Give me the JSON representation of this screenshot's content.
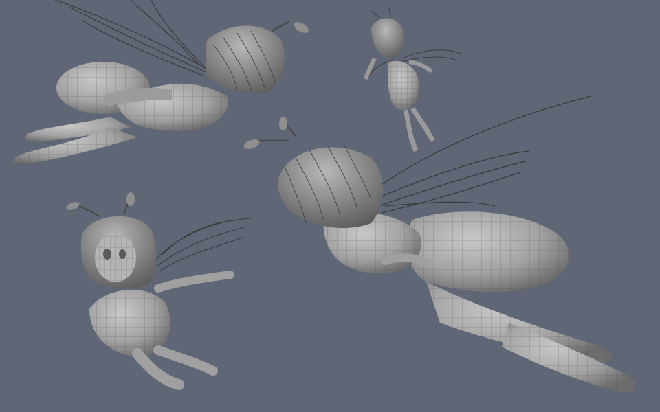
{
  "scene": {
    "background_color": "#5f6776",
    "mesh_color": "#a9a9a9",
    "mesh_shadow_color": "#6f6f6f",
    "wireframe_color": "#3a3a3a",
    "figures": [
      {
        "id": "fairy-top-left",
        "pose": "flying-side-view"
      },
      {
        "id": "fairy-top-right",
        "pose": "flying-back-view"
      },
      {
        "id": "fairy-bottom-left",
        "pose": "flying-front-view"
      },
      {
        "id": "fairy-bottom-right",
        "pose": "flying-side-view-large"
      }
    ]
  }
}
